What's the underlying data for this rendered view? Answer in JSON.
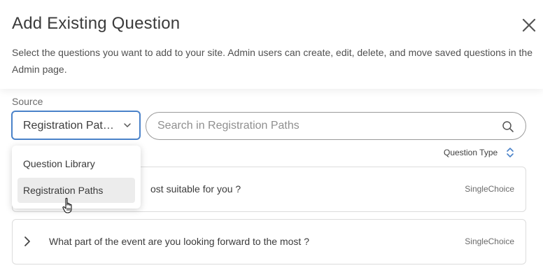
{
  "dialog": {
    "title": "Add Existing Question",
    "description": "Select the questions you want to add to your site. Admin users can create, edit, delete, and move saved questions in the Admin page."
  },
  "source": {
    "label": "Source",
    "selected": "Registration Pat…",
    "options": [
      "Question Library",
      "Registration Paths"
    ],
    "hovered_option": "Registration Paths"
  },
  "search": {
    "placeholder": "Search in Registration Paths",
    "value": ""
  },
  "sort": {
    "label": "Question Type"
  },
  "questions": [
    {
      "text": "ost suitable for you ?",
      "type": "SingleChoice"
    },
    {
      "text": "What part of the event are you looking forward to the most ?",
      "type": "SingleChoice"
    }
  ],
  "icons": {
    "close": "close-icon",
    "dropdown": "chevron-down-icon",
    "search": "search-icon",
    "sort": "sort-icon",
    "expand": "chevron-right-icon",
    "cursor": "hand-pointer-cursor"
  },
  "colors": {
    "accent": "#4a82c9",
    "hover_bg": "#ececec"
  }
}
